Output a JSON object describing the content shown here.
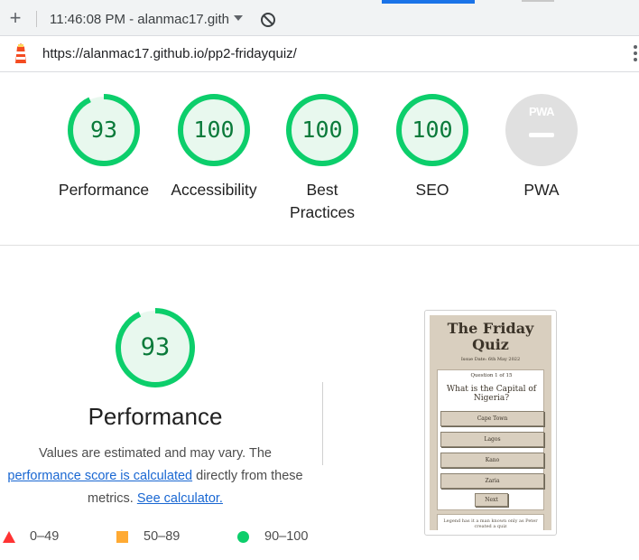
{
  "toolbar": {
    "new_tab_label": "+",
    "session_label": "11:46:08 PM - alanmac17.githu",
    "icons": [
      "plus-icon",
      "chevron-down-icon",
      "block-icon"
    ]
  },
  "urlbar": {
    "url": "https://alanmac17.github.io/pp2-fridayquiz/"
  },
  "gauges": [
    {
      "label": "Performance",
      "score": "93",
      "value": 93
    },
    {
      "label": "Accessibility",
      "score": "100",
      "value": 100
    },
    {
      "label": "Best Practices",
      "score": "100",
      "value": 100
    },
    {
      "label": "SEO",
      "score": "100",
      "value": 100
    },
    {
      "label": "PWA",
      "score": "",
      "value": null
    }
  ],
  "pwa_badge": "PWA",
  "performance": {
    "score": "93",
    "value": 93,
    "title": "Performance",
    "desc_part1": "Values are estimated and may vary. The",
    "desc_link1": "performance score is calculated",
    "desc_part2": "directly from these metrics.",
    "desc_link2": "See calculator."
  },
  "legend": [
    {
      "range": "0–49",
      "color": "#ff3333",
      "shape": "triangle"
    },
    {
      "range": "50–89",
      "color": "#ffaa33",
      "shape": "square"
    },
    {
      "range": "90–100",
      "color": "#0cce6b",
      "shape": "circle"
    }
  ],
  "colors": {
    "pass": "#0cce6b",
    "pass_fill": "#e8f8ee",
    "score_text": "#0a7a3a",
    "link": "#1967d2",
    "pwa_gray": "#e0e0e0"
  },
  "thumbnail": {
    "title": "The Friday Quiz",
    "issue_date": "Issue Date: 6th May 2022",
    "question_number": "Question 1 of 15",
    "question": "What is the Capital of Nigeria?",
    "options": [
      "Cape Town",
      "Lagos",
      "Kano",
      "Zaria"
    ],
    "next": "Next",
    "footer": "Legend has it a man known only as Peter created a quiz"
  }
}
